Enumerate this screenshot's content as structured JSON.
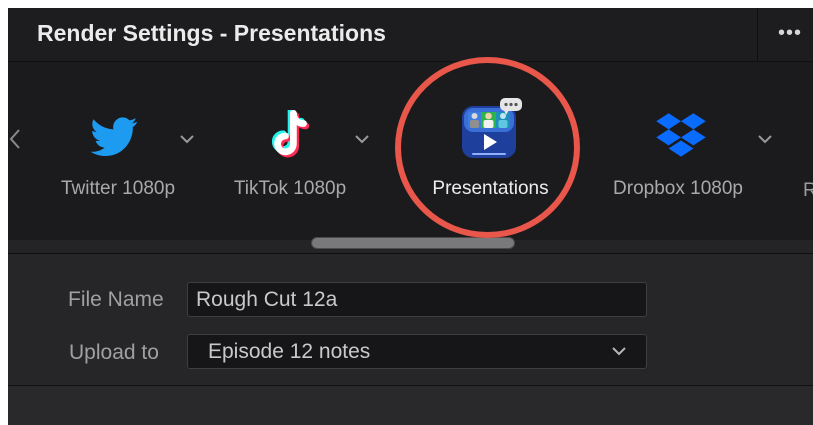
{
  "window": {
    "title": "Render Settings - Presentations",
    "more_icon": "more-horizontal-icon",
    "more_label": "•••"
  },
  "presets": {
    "items": [
      {
        "label": "Twitter 1080p",
        "icon": "twitter-bird-icon",
        "active": false
      },
      {
        "label": "TikTok 1080p",
        "icon": "tiktok-icon",
        "active": false
      },
      {
        "label": "Presentations",
        "icon": "presentations-icon",
        "active": true
      },
      {
        "label": "Dropbox 1080p",
        "icon": "dropbox-icon",
        "active": false
      }
    ],
    "cut_off_label": "R",
    "highlight_color": "#e8574a"
  },
  "form": {
    "file_name_label": "File Name",
    "file_name_value": "Rough Cut 12a",
    "upload_label": "Upload to",
    "upload_value": "Episode 12 notes"
  },
  "colors": {
    "twitter_blue": "#1d9bf0",
    "dropbox_blue": "#0a6cff",
    "panel_bg": "#242427"
  }
}
